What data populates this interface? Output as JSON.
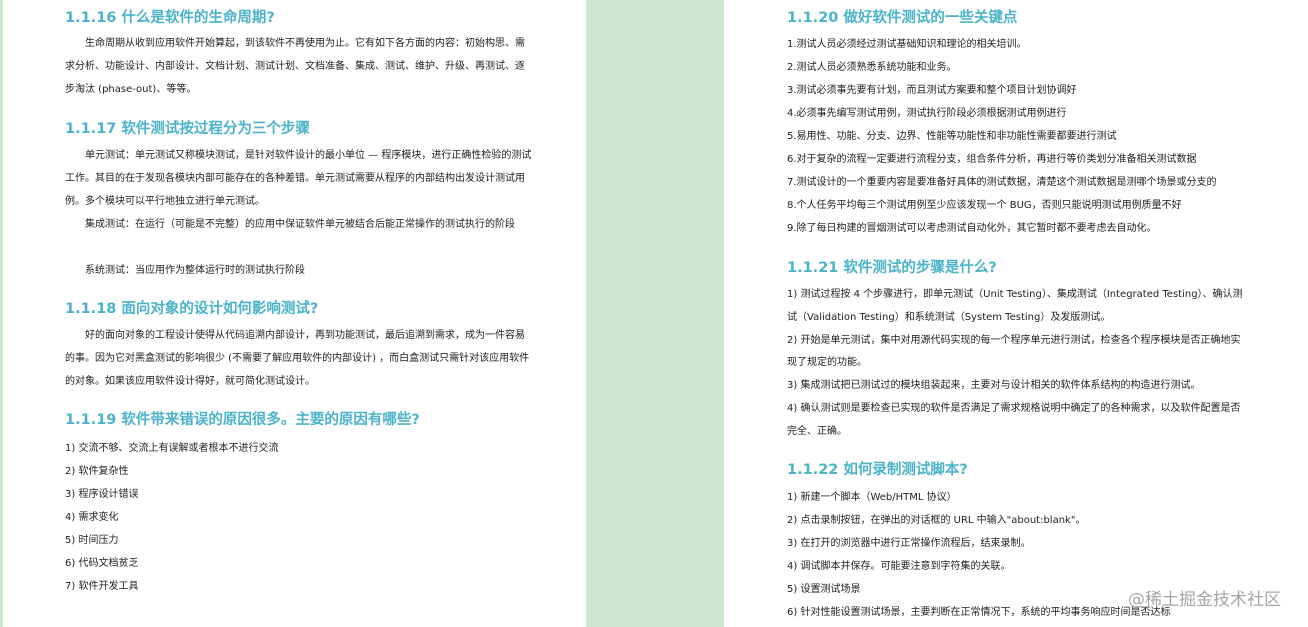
{
  "left": {
    "s1116": {
      "title": "1.1.16 什么是软件的生命周期?",
      "body": "生命周期从收到应用软件开始算起，到该软件不再使用为止。它有如下各方面的内容：初始构思、需求分析、功能设计、内部设计、文档计划、测试计划、文档准备、集成、测试、维护、升级、再测试、逐步淘汰 (phase-out)、等等。"
    },
    "s1117": {
      "title": "1.1.17 软件测试按过程分为三个步骤",
      "p1": "单元测试：单元测试又称模块测试，是针对软件设计的最小单位 — 程序模块，进行正确性检验的测试工作。其目的在于发现各模块内部可能存在的各种差错。单元测试需要从程序的内部结构出发设计测试用例。多个模块可以平行地独立进行单元测试。",
      "p2": "集成测试：在运行（可能是不完整）的应用中保证软件单元被结合后能正常操作的测试执行的阶段",
      "p3": "系统测试：当应用作为整体运行时的测试执行阶段"
    },
    "s1118": {
      "title": "1.1.18 面向对象的设计如何影响测试?",
      "body": "好的面向对象的工程设计使得从代码追溯内部设计，再到功能测试，最后追溯到需求，成为一件容易的事。因为它对黑盒测试的影响很少 (不需要了解应用软件的内部设计) ，而白盒测试只需针对该应用软件的对象。如果该应用软件设计得好，就可简化测试设计。"
    },
    "s1119": {
      "title": "1.1.19 软件带来错误的原因很多。主要的原因有哪些?",
      "items": [
        "1)  交流不够、交流上有误解或者根本不进行交流",
        "2)  软件复杂性",
        "3)  程序设计错误",
        "4)  需求变化",
        "5)  时间压力",
        "6)  代码文档贫乏",
        "7)  软件开发工具"
      ]
    }
  },
  "right": {
    "s1120": {
      "title": "1.1.20 做好软件测试的一些关键点",
      "items": [
        "1.测试人员必须经过测试基础知识和理论的相关培训。",
        "2.测试人员必须熟悉系统功能和业务。",
        "3.测试必须事先要有计划，而且测试方案要和整个项目计划协调好",
        "4.必须事先编写测试用例，测试执行阶段必须根据测试用例进行",
        "5.易用性、功能、分支、边界、性能等功能性和非功能性需要都要进行测试",
        "6.对于复杂的流程一定要进行流程分支，组合条件分析，再进行等价类划分准备相关测试数据",
        "7.测试设计的一个重要内容是要准备好具体的测试数据，清楚这个测试数据是测哪个场景或分支的",
        "8.个人任务平均每三个测试用例至少应该发现一个 BUG，否则只能说明测试用例质量不好",
        "9.除了每日构建的冒烟测试可以考虑测试自动化外，其它暂时都不要考虑去自动化。"
      ]
    },
    "s1121": {
      "title": "1.1.21 软件测试的步骤是什么?",
      "items": [
        "1)  测试过程按  4  个步骤进行，即单元测试（Unit Testing）、集成测试（Integrated Testing）、确认测试（Validation Testing）和系统测试（System Testing）及发版测试。",
        "2)  开始是单元测试，集中对用源代码实现的每一个程序单元进行测试，检查各个程序模块是否正确地实现了规定的功能。",
        "3)  集成测试把已测试过的模块组装起来，主要对与设计相关的软件体系结构的构造进行测试。",
        "4)  确认测试则是要检查已实现的软件是否满足了需求规格说明中确定了的各种需求，以及软件配置是否完全、正确。"
      ]
    },
    "s1122": {
      "title": "1.1.22 如何录制测试脚本?",
      "items": [
        "1)  新建一个脚本（Web/HTML  协议）",
        "2)  点击录制按钮，在弹出的对话框的  URL  中输入\"about:blank\"。",
        "3)  在打开的浏览器中进行正常操作流程后，结束录制。",
        "4)  调试脚本并保存。可能要注意到字符集的关联。",
        "5)  设置测试场景",
        "6)  针对性能设置测试场景，主要判断在正常情况下，系统的平均事务响应时间是否达标"
      ]
    }
  },
  "watermark": "@稀土掘金技术社区",
  "colors": {
    "heading": "#4cb3c8",
    "gutter": "#cde8cf",
    "text": "#222222"
  }
}
